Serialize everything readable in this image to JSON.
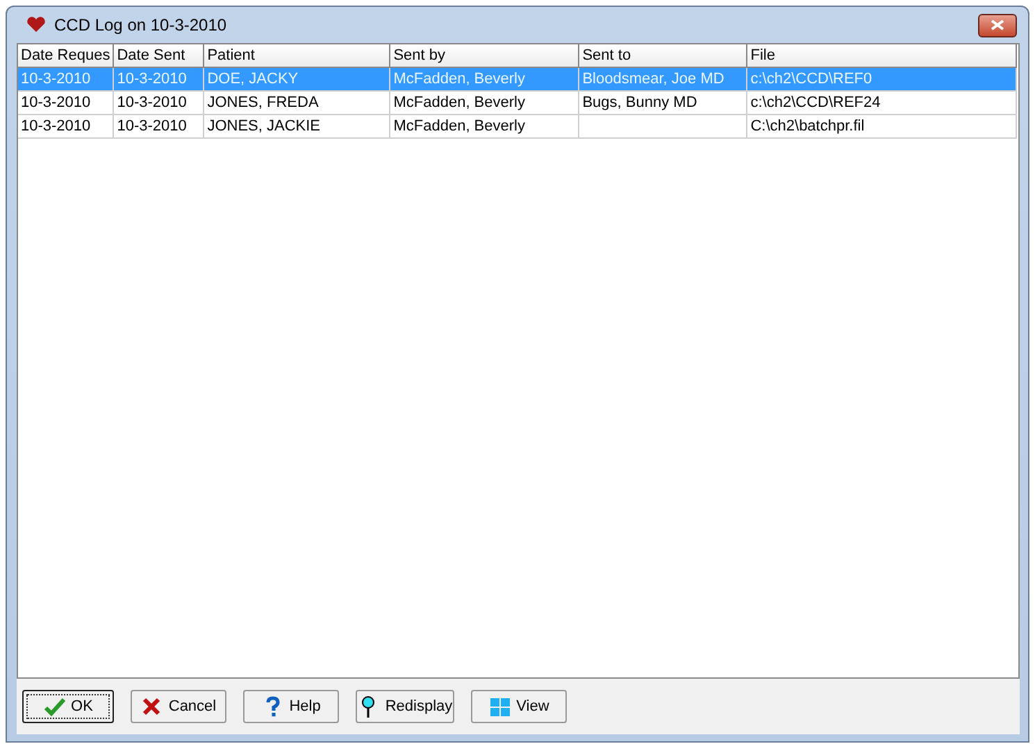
{
  "window": {
    "title": "CCD Log on 10-3-2010"
  },
  "table": {
    "columns": [
      "Date Reques",
      "Date Sent",
      "Patient",
      "Sent by",
      "Sent to",
      "File"
    ],
    "rows": [
      {
        "cells": [
          "10-3-2010",
          "10-3-2010",
          "DOE, JACKY",
          "McFadden, Beverly",
          "Bloodsmear, Joe MD",
          "c:\\ch2\\CCD\\REF0"
        ],
        "selected": true
      },
      {
        "cells": [
          "10-3-2010",
          "10-3-2010",
          "JONES, FREDA",
          "McFadden, Beverly",
          "Bugs, Bunny MD",
          "c:\\ch2\\CCD\\REF24"
        ],
        "selected": false
      },
      {
        "cells": [
          "10-3-2010",
          "10-3-2010",
          "JONES, JACKIE",
          "McFadden, Beverly",
          "",
          "C:\\ch2\\batchpr.fil"
        ],
        "selected": false
      }
    ]
  },
  "buttons": [
    {
      "label": "OK",
      "kind": "ok",
      "default": true
    },
    {
      "label": "Cancel",
      "kind": "cancel",
      "default": false
    },
    {
      "label": "Help",
      "kind": "help",
      "default": false
    },
    {
      "label": "Redisplay",
      "kind": "redisplay",
      "default": false
    },
    {
      "label": "View",
      "kind": "view",
      "default": false
    }
  ]
}
